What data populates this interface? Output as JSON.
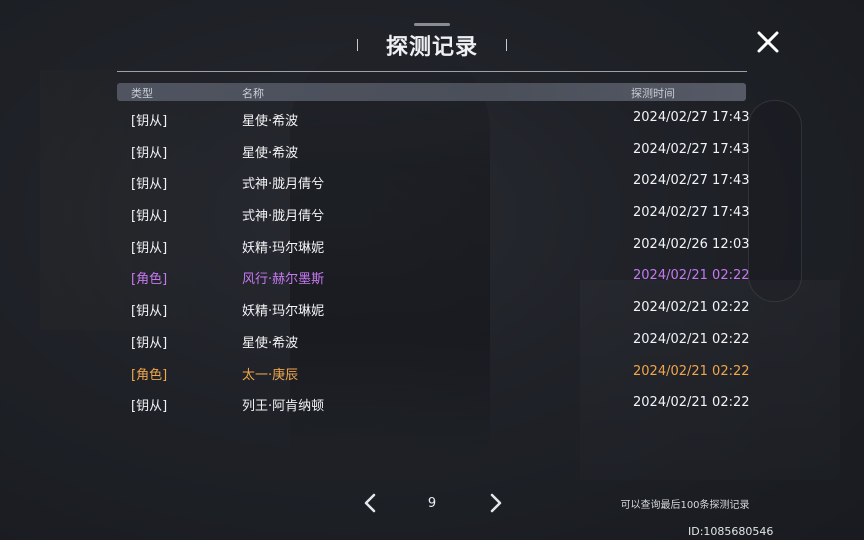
{
  "dialog": {
    "title": "探测记录"
  },
  "table": {
    "headers": {
      "type": "类型",
      "name": "名称",
      "time": "探测时间"
    },
    "rows": [
      {
        "type": "[钥从]",
        "name": "星使·希波",
        "time": "2024/02/27 17:43",
        "tier": "normal"
      },
      {
        "type": "[钥从]",
        "name": "星使·希波",
        "time": "2024/02/27 17:43",
        "tier": "normal"
      },
      {
        "type": "[钥从]",
        "name": "式神·胧月倩兮",
        "time": "2024/02/27 17:43",
        "tier": "normal"
      },
      {
        "type": "[钥从]",
        "name": "式神·胧月倩兮",
        "time": "2024/02/27 17:43",
        "tier": "normal"
      },
      {
        "type": "[钥从]",
        "name": "妖精·玛尔琳妮",
        "time": "2024/02/26 12:03",
        "tier": "normal"
      },
      {
        "type": "[角色]",
        "name": "风行·赫尔墨斯",
        "time": "2024/02/21 02:22",
        "tier": "purple"
      },
      {
        "type": "[钥从]",
        "name": "妖精·玛尔琳妮",
        "time": "2024/02/21 02:22",
        "tier": "normal"
      },
      {
        "type": "[钥从]",
        "name": "星使·希波",
        "time": "2024/02/21 02:22",
        "tier": "normal"
      },
      {
        "type": "[角色]",
        "name": "太一·庚辰",
        "time": "2024/02/21 02:22",
        "tier": "orange"
      },
      {
        "type": "[钥从]",
        "name": "列王·阿肯纳顿",
        "time": "2024/02/21 02:22",
        "tier": "normal"
      }
    ]
  },
  "pager": {
    "page": "9",
    "note": "可以查询最后100条探测记录"
  },
  "footer": {
    "uid": "ID:1085680546"
  },
  "colors": {
    "purple_tier": "#c678f0",
    "orange_tier": "#f0a64a",
    "normal_tier": "#f2f3f5"
  },
  "icons": {
    "close": "close-icon",
    "prev": "chevron-left-icon",
    "next": "chevron-right-icon"
  }
}
